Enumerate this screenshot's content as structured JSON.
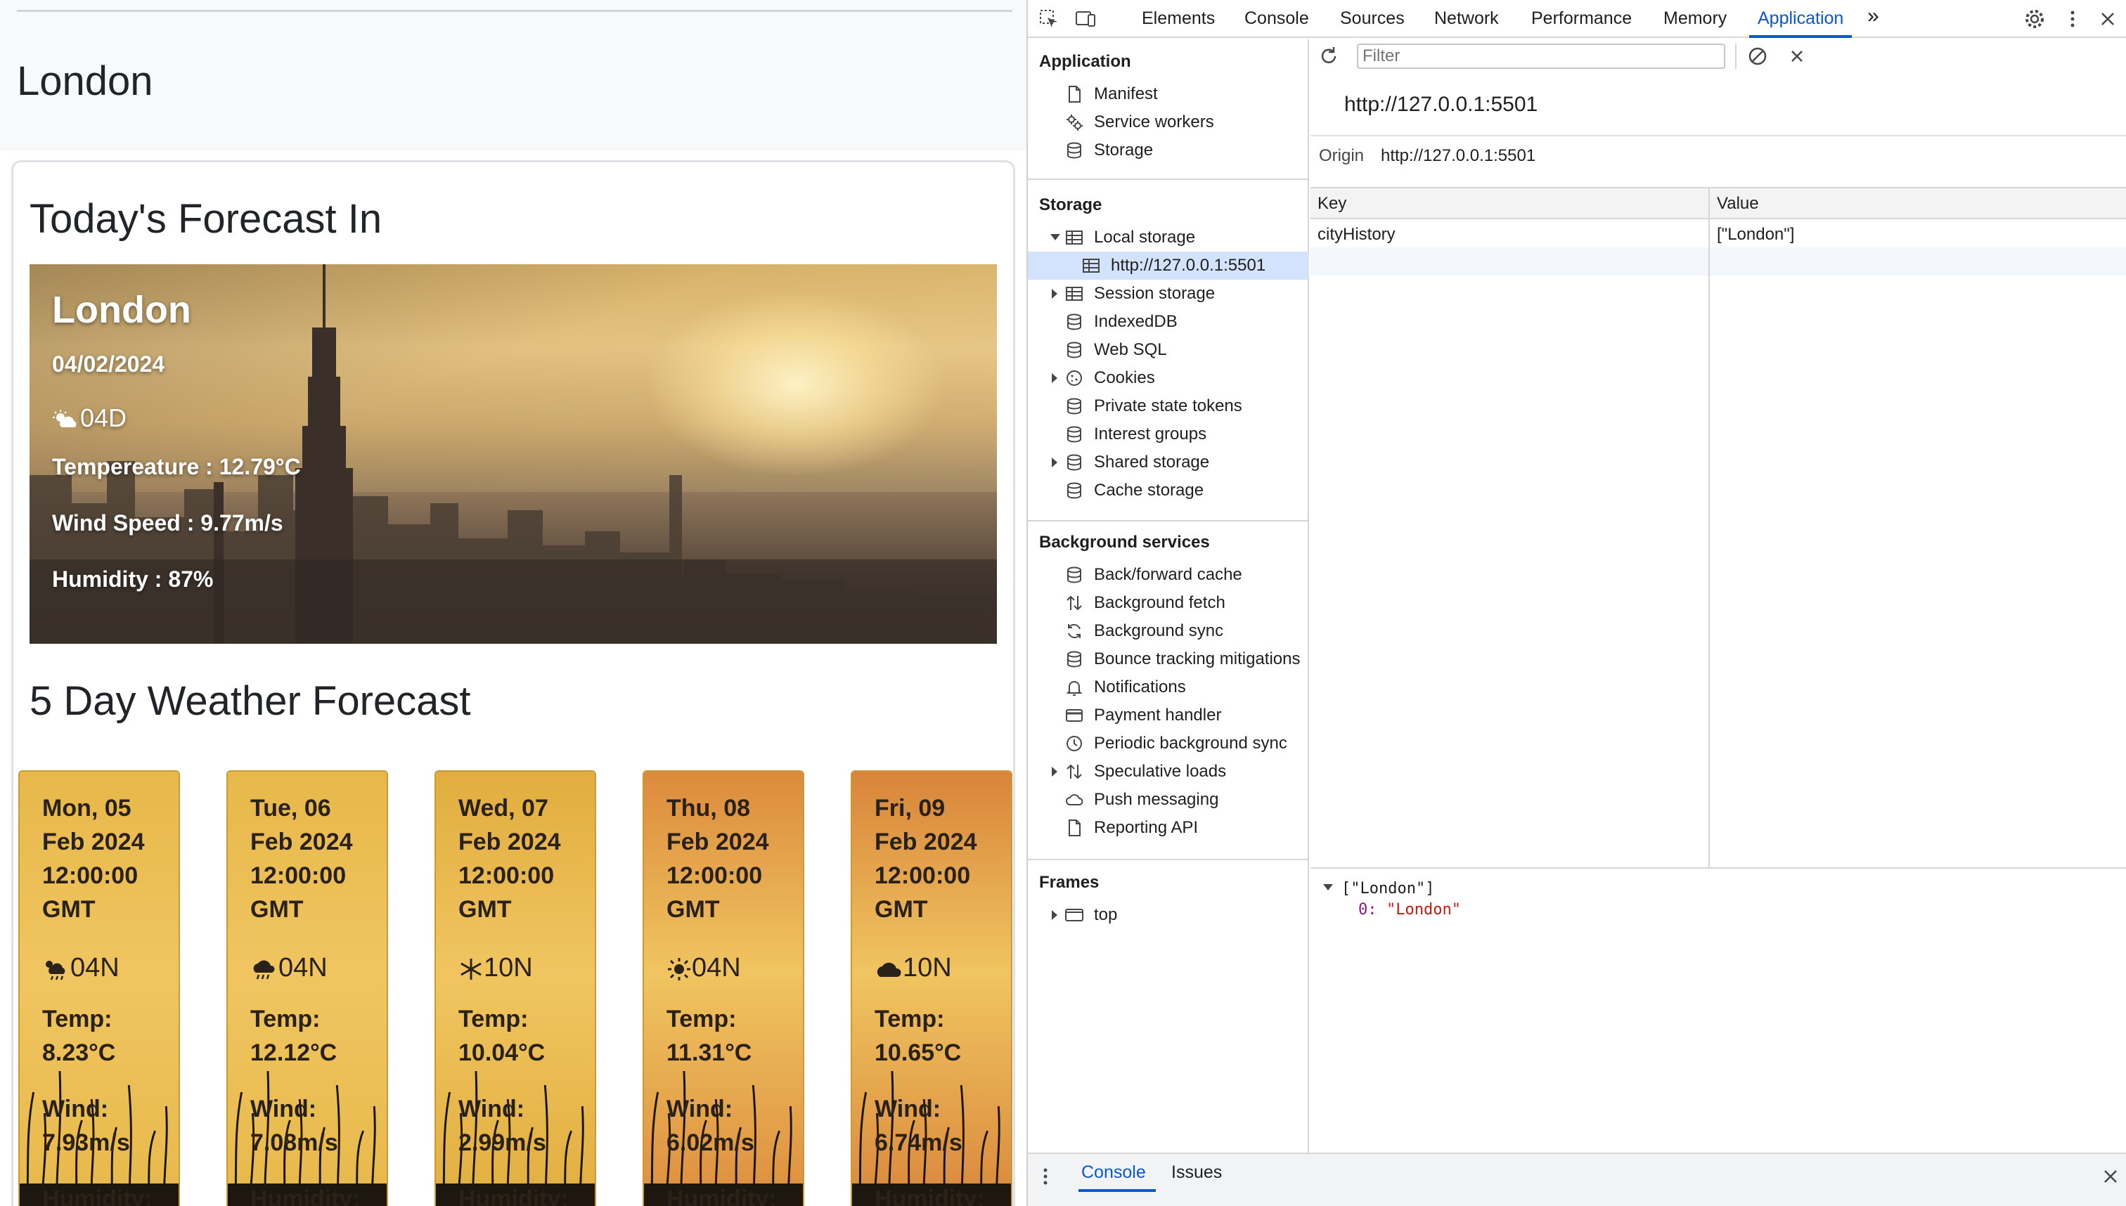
{
  "weather_page": {
    "header_city": "London",
    "today_heading": "Today's Forecast In",
    "today": {
      "city": "London",
      "date": "04/02/2024",
      "icon_code": "04D",
      "icon": "cloud-sun-icon",
      "temperature": "Tempereature : 12.79°C",
      "wind": "Wind Speed : 9.77m/s",
      "humidity": "Humidity : 87%"
    },
    "forecast_heading": "5 Day Weather Forecast",
    "days": [
      {
        "line1": "Mon, 05",
        "line2": "Feb 2024",
        "line3": "12:00:00",
        "line4": "GMT",
        "icon": "cloud-sun-rain-icon",
        "icon_code": "04N",
        "temp_label": "Temp:",
        "temp": "8.23°C",
        "wind_label": "Wind:",
        "wind": "7.93m/s",
        "humidity_label": "Humidity:",
        "color": "#e7b84a"
      },
      {
        "line1": "Tue, 06",
        "line2": "Feb 2024",
        "line3": "12:00:00",
        "line4": "GMT",
        "icon": "cloud-rain-icon",
        "icon_code": "04N",
        "temp_label": "Temp:",
        "temp": "12.12°C",
        "wind_label": "Wind:",
        "wind": "7.08m/s",
        "humidity_label": "Humidity:",
        "color": "#e7b84a"
      },
      {
        "line1": "Wed, 07",
        "line2": "Feb 2024",
        "line3": "12:00:00",
        "line4": "GMT",
        "icon": "snowflake-icon",
        "icon_code": "10N",
        "temp_label": "Temp:",
        "temp": "10.04°C",
        "wind_label": "Wind:",
        "wind": "2.99m/s",
        "humidity_label": "Humidity:",
        "color": "#e1ad3e"
      },
      {
        "line1": "Thu, 08",
        "line2": "Feb 2024",
        "line3": "12:00:00",
        "line4": "GMT",
        "icon": "sun-icon",
        "icon_code": "04N",
        "temp_label": "Temp:",
        "temp": "11.31°C",
        "wind_label": "Wind:",
        "wind": "6.02m/s",
        "humidity_label": "Humidity:",
        "color": "#dc8a3c"
      },
      {
        "line1": "Fri, 09",
        "line2": "Feb 2024",
        "line3": "12:00:00",
        "line4": "GMT",
        "icon": "cloud-icon",
        "icon_code": "10N",
        "temp_label": "Temp:",
        "temp": "10.65°C",
        "wind_label": "Wind:",
        "wind": "6.74m/s",
        "humidity_label": "Humidity:",
        "color": "#d9843a"
      }
    ]
  },
  "devtools": {
    "tabs": [
      "Elements",
      "Console",
      "Sources",
      "Network",
      "Performance",
      "Memory",
      "Application"
    ],
    "active_tab": "Application",
    "toolbar_icons": [
      "inspect-element-icon",
      "device-toolbar-icon",
      "more-tabs-icon",
      "settings-gear-icon",
      "kebab-menu-icon",
      "close-icon"
    ],
    "sidebar": {
      "application_section": "Application",
      "application_items": [
        {
          "label": "Manifest",
          "icon": "file-icon"
        },
        {
          "label": "Service workers",
          "icon": "gears-icon"
        },
        {
          "label": "Storage",
          "icon": "database-icon"
        }
      ],
      "storage_section": "Storage",
      "storage_items": [
        {
          "label": "Local storage",
          "icon": "table-icon",
          "expanded": true
        },
        {
          "label": "http://127.0.0.1:5501",
          "icon": "table-icon",
          "selected": true
        },
        {
          "label": "Session storage",
          "icon": "table-icon",
          "expanded": false
        },
        {
          "label": "IndexedDB",
          "icon": "database-icon"
        },
        {
          "label": "Web SQL",
          "icon": "database-icon"
        },
        {
          "label": "Cookies",
          "icon": "cookie-icon",
          "expanded": false
        },
        {
          "label": "Private state tokens",
          "icon": "database-icon"
        },
        {
          "label": "Interest groups",
          "icon": "database-icon"
        },
        {
          "label": "Shared storage",
          "icon": "database-icon",
          "expanded": false
        },
        {
          "label": "Cache storage",
          "icon": "database-icon"
        }
      ],
      "background_section": "Background services",
      "background_items": [
        {
          "label": "Back/forward cache",
          "icon": "database-icon"
        },
        {
          "label": "Background fetch",
          "icon": "up-down-arrows-icon"
        },
        {
          "label": "Background sync",
          "icon": "sync-icon"
        },
        {
          "label": "Bounce tracking mitigations",
          "icon": "database-icon"
        },
        {
          "label": "Notifications",
          "icon": "bell-icon"
        },
        {
          "label": "Payment handler",
          "icon": "credit-card-icon"
        },
        {
          "label": "Periodic background sync",
          "icon": "clock-icon"
        },
        {
          "label": "Speculative loads",
          "icon": "up-down-arrows-icon",
          "expanded": false
        },
        {
          "label": "Push messaging",
          "icon": "cloud-icon"
        },
        {
          "label": "Reporting API",
          "icon": "file-icon"
        }
      ],
      "frames_section": "Frames",
      "frames_items": [
        {
          "label": "top",
          "icon": "frame-window-icon",
          "expanded": false
        }
      ]
    },
    "main": {
      "filter_placeholder": "Filter",
      "origin_heading": "http://127.0.0.1:5501",
      "origin_label": "Origin",
      "origin_value": "http://127.0.0.1:5501",
      "columns": [
        "Key",
        "Value"
      ],
      "rows": [
        {
          "key": "cityHistory",
          "value": "[\"London\"]"
        }
      ],
      "preview_line1": "[\"London\"]",
      "preview_index": "0:",
      "preview_value": "\"London\""
    },
    "drawer": {
      "tabs": [
        "Console",
        "Issues"
      ],
      "active_tab": "Console"
    },
    "accent_color": "#0b57d0"
  }
}
